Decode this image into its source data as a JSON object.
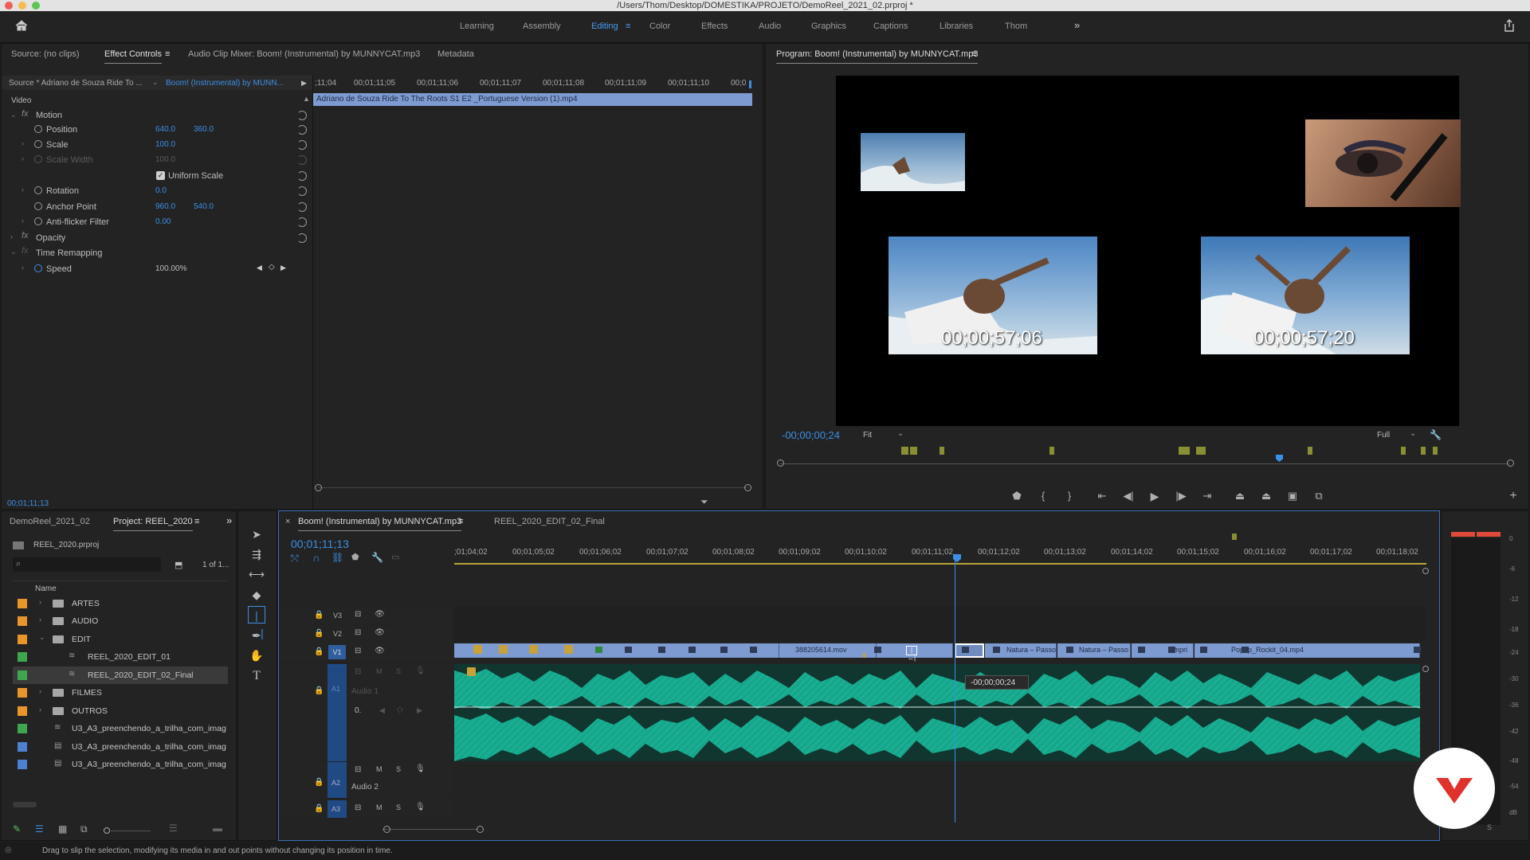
{
  "window": {
    "title": "/Users/Thom/Desktop/DOMESTIKA/PROJETO/DemoReel_2021_02.prproj *"
  },
  "workspaces": [
    {
      "label": "Learning"
    },
    {
      "label": "Assembly"
    },
    {
      "label": "Editing"
    },
    {
      "label": "Color"
    },
    {
      "label": "Effects"
    },
    {
      "label": "Audio"
    },
    {
      "label": "Graphics"
    },
    {
      "label": "Captions"
    },
    {
      "label": "Libraries"
    },
    {
      "label": "Thom"
    }
  ],
  "source_panel": {
    "tabs": [
      "Source: (no clips)",
      "Effect Controls",
      "Audio Clip Mixer: Boom! (Instrumental) by MUNNYCAT.mp3",
      "Metadata"
    ],
    "source_name": "Source * Adriano de Souza Ride To ...",
    "clip_name": "Boom! (Instrumental) by MUNN...",
    "ruler": [
      ";11;04",
      "00;01;11;05",
      "00;01;11;06",
      "00;01;11;07",
      "00;01;11;08",
      "00;01;11;09",
      "00;01;11;10",
      "00;0"
    ],
    "clip_bar": "Adriano de Souza Ride To The Roots S1 E2 _Portuguese Version (1).mp4",
    "section": "Video",
    "props": {
      "motion": "Motion",
      "position": {
        "label": "Position",
        "x": "640.0",
        "y": "360.0"
      },
      "scale": {
        "label": "Scale",
        "value": "100.0"
      },
      "scale_width": {
        "label": "Scale Width",
        "value": "100.0"
      },
      "uniform": "Uniform Scale",
      "rotation": {
        "label": "Rotation",
        "value": "0.0"
      },
      "anchor": {
        "label": "Anchor Point",
        "x": "960.0",
        "y": "540.0"
      },
      "antiflicker": {
        "label": "Anti-flicker Filter",
        "value": "0.00"
      },
      "opacity": "Opacity",
      "time_remap": "Time Remapping",
      "speed": {
        "label": "Speed",
        "value": "100.00%"
      }
    },
    "timecode": "00;01;11;13"
  },
  "program": {
    "title": "Program: Boom! (Instrumental) by MUNNYCAT.mp3",
    "timecode": "-00;00;00;24",
    "fit": "Fit",
    "quality": "Full",
    "overlay_left": "00;00;57;06",
    "overlay_right": "00;00;57;20"
  },
  "project": {
    "tabs": [
      "DemoReel_2021_02",
      "Project: REEL_2020"
    ],
    "file": "REEL_2020.prproj",
    "count": "1 of 1...",
    "col_name": "Name",
    "items": [
      {
        "name": "ARTES",
        "color": "#e8952c",
        "type": "folder"
      },
      {
        "name": "AUDIO",
        "color": "#e8952c",
        "type": "folder"
      },
      {
        "name": "EDIT",
        "color": "#e8952c",
        "type": "folder"
      },
      {
        "name": "REEL_2020_EDIT_01",
        "color": "#3fa64f",
        "type": "seq"
      },
      {
        "name": "REEL_2020_EDIT_02_Final",
        "color": "#3fa64f",
        "type": "seq"
      },
      {
        "name": "FILMES",
        "color": "#e8952c",
        "type": "folder"
      },
      {
        "name": "OUTROS",
        "color": "#e8952c",
        "type": "folder"
      },
      {
        "name": "U3_A3_preenchendo_a_trilha_com_imag",
        "color": "#3fa64f",
        "type": "seq"
      },
      {
        "name": "U3_A3_preenchendo_a_trilha_com_imag",
        "color": "#4f7fcf",
        "type": "file"
      },
      {
        "name": "U3_A3_preenchendo_a_trilha_com_imag",
        "color": "#4f7fcf",
        "type": "file"
      }
    ]
  },
  "timeline": {
    "tabs": [
      "Boom! (Instrumental) by MUNNYCAT.mp3",
      "REEL_2020_EDIT_02_Final"
    ],
    "timecode": "00;01;11;13",
    "ruler": [
      ";01;04;02",
      "00;01;05;02",
      "00;01;06;02",
      "00;01;07;02",
      "00;01;08;02",
      "00;01;09;02",
      "00;01;10;02",
      "00;01;11;02",
      "00;01;12;02",
      "00;01;13;02",
      "00;01;14;02",
      "00;01;15;02",
      "00;01;16;02",
      "00;01;17;02",
      "00;01;18;02"
    ],
    "tracks": {
      "v3": "V3",
      "v2": "V2",
      "v1": "V1",
      "a1": "A1",
      "a2": "A2",
      "a3": "A3",
      "audio1": "Audio 1",
      "audio2": "Audio 2",
      "m": "M",
      "s": "S",
      "a1_val": "0."
    },
    "clips": {
      "c1": "388205614.mov",
      "c2": "Natura – Passo",
      "c3": "Natura – Passo",
      "c4": "Impri",
      "c5": "Popup_Rockit_04.mp4"
    },
    "slip_tooltip": "-00;00;00;24",
    "meter_labels": [
      "0",
      "-6",
      "-12",
      "-18",
      "-24",
      "-30",
      "-36",
      "-42",
      "-48",
      "-54",
      "dB"
    ],
    "meter_s": "S"
  },
  "status": {
    "text": "Drag to slip the selection, modifying its media in and out points without changing its position in time."
  }
}
